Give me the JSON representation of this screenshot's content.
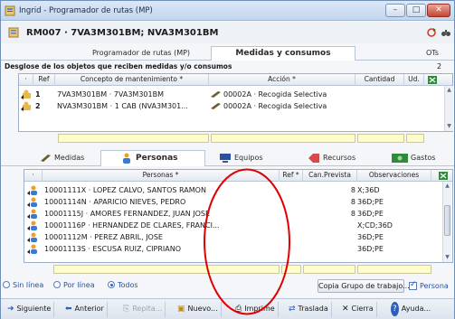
{
  "window": {
    "title": "Ingrid - Programador de rutas (MP)",
    "buttons": [
      "–",
      "□",
      "✕"
    ]
  },
  "record": {
    "title": "RM007 · 7VA3M301BM; NVA3M301BM"
  },
  "top_tabs": [
    {
      "label": "Programador de rutas (MP)",
      "active": false
    },
    {
      "label": "Medidas y consumos",
      "active": true
    },
    {
      "label": "OTs",
      "active": false
    }
  ],
  "section": {
    "label": "Desglose de los objetos que reciben medidas y/o consumos",
    "count": "2"
  },
  "upper_grid": {
    "columns": [
      "·",
      "Ref",
      "Concepto de mantenimiento *",
      "Acción *",
      "Cantidad",
      "Ud."
    ],
    "rows": [
      {
        "ref": "1",
        "concepto": "7VA3M301BM · 7VA3M301BM",
        "accion": "00002A · Recogida Selectiva",
        "cantidad": "",
        "ud": ""
      },
      {
        "ref": "2",
        "concepto": "NVA3M301BM · 1 CAB (NVA3M301...",
        "accion": "00002A · Recogida Selectiva",
        "cantidad": "",
        "ud": ""
      }
    ]
  },
  "mid_tabs": [
    {
      "label": "Medidas",
      "icon": "pencil-icon",
      "active": false
    },
    {
      "label": "Personas",
      "icon": "people-icon",
      "active": true
    },
    {
      "label": "Equipos",
      "icon": "monitor-icon",
      "active": false
    },
    {
      "label": "Recursos",
      "icon": "tag-icon",
      "active": false
    },
    {
      "label": "Gastos",
      "icon": "money-icon",
      "active": false
    }
  ],
  "persons_grid": {
    "columns": [
      "·",
      "Personas *",
      "Ref *",
      "Can.Prevista",
      "Observaciones"
    ],
    "rows": [
      {
        "persona": "10001111X · LOPEZ CALVO, SANTOS RAMON",
        "ref": "",
        "prevista": "8",
        "obs": "X;36D"
      },
      {
        "persona": "10001114N · APARICIO NIEVES, PEDRO",
        "ref": "",
        "prevista": "8",
        "obs": "36D;PE"
      },
      {
        "persona": "10001115J · AMORES FERNANDEZ, JUAN JOSE",
        "ref": "",
        "prevista": "8",
        "obs": "36D;PE"
      },
      {
        "persona": "10001116P · HERNANDEZ DE CLARES, FRANCI...",
        "ref": "",
        "prevista": "",
        "obs": "X;CD;36D"
      },
      {
        "persona": "10001112M · PEREZ ABRIL, JOSE",
        "ref": "",
        "prevista": "",
        "obs": "36D;PE"
      },
      {
        "persona": "10001113S · ESCUSA RUIZ, CIPRIANO",
        "ref": "",
        "prevista": "",
        "obs": "36D;PE"
      }
    ]
  },
  "filter": {
    "options": [
      {
        "label": "Sin línea",
        "checked": false
      },
      {
        "label": "Por línea",
        "checked": false
      },
      {
        "label": "Todos",
        "checked": true
      }
    ],
    "copy_button": "Copia Grupo de trabajo...",
    "persona_checkbox": "Persona",
    "persona_checked": true
  },
  "footer": {
    "buttons": [
      {
        "label": "Siguiente",
        "icon": "arrow-right-icon",
        "disabled": false
      },
      {
        "label": "Anterior",
        "icon": "arrow-left-icon",
        "disabled": false
      },
      {
        "label": "Repita...",
        "icon": "repeat-icon",
        "disabled": true
      },
      {
        "label": "Nuevo...",
        "icon": "new-icon",
        "disabled": false
      },
      {
        "label": "Imprime",
        "icon": "printer-icon",
        "disabled": false
      },
      {
        "label": "Traslada",
        "icon": "move-icon",
        "disabled": false
      },
      {
        "label": "Cierra",
        "icon": "close-icon",
        "disabled": false
      },
      {
        "label": "Ayuda...",
        "icon": "help-icon",
        "disabled": false
      }
    ]
  },
  "colors": {
    "accent": "#2b5fb9",
    "annotation": "#e00000",
    "input_strip": "#fffccc"
  }
}
